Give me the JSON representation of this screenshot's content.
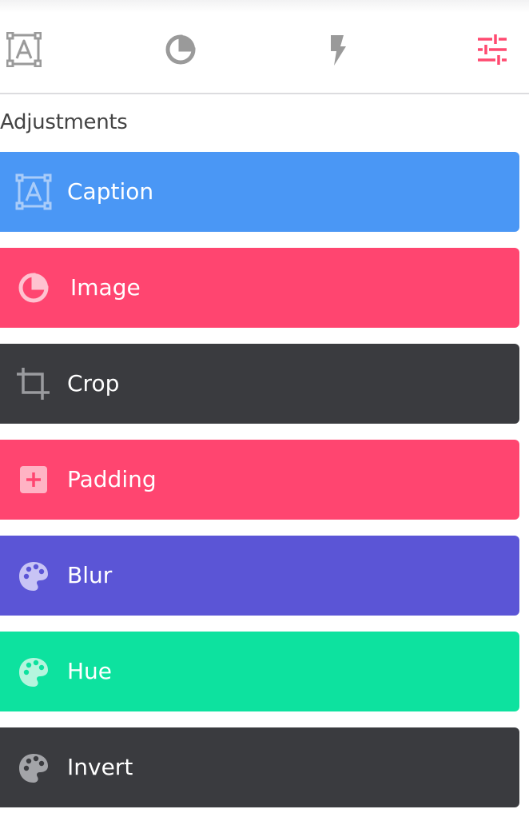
{
  "tabs": [
    {
      "name": "caption",
      "icon": "text-box-icon",
      "color": "#9a9a9a",
      "active": false
    },
    {
      "name": "image",
      "icon": "pie-chart-icon",
      "color": "#9a9a9a",
      "active": false
    },
    {
      "name": "effects",
      "icon": "lightning-icon",
      "color": "#9a9a9a",
      "active": false
    },
    {
      "name": "adjustments",
      "icon": "sliders-icon",
      "color": "#ff4a70",
      "active": true
    }
  ],
  "section": {
    "title": "Adjustments"
  },
  "buttons": [
    {
      "label": "Caption",
      "icon": "text-box-icon",
      "color": "#4a97f5"
    },
    {
      "label": "Image",
      "icon": "pie-chart-icon",
      "color": "#ff4570"
    },
    {
      "label": "Crop",
      "icon": "crop-icon",
      "color": "#3a3b3f"
    },
    {
      "label": "Padding",
      "icon": "plus-box-icon",
      "color": "#ff4570"
    },
    {
      "label": "Blur",
      "icon": "palette-icon",
      "color": "#5b55d6"
    },
    {
      "label": "Hue",
      "icon": "palette-icon",
      "color": "#0de29f"
    },
    {
      "label": "Invert",
      "icon": "palette-icon",
      "color": "#3a3b3f"
    }
  ]
}
